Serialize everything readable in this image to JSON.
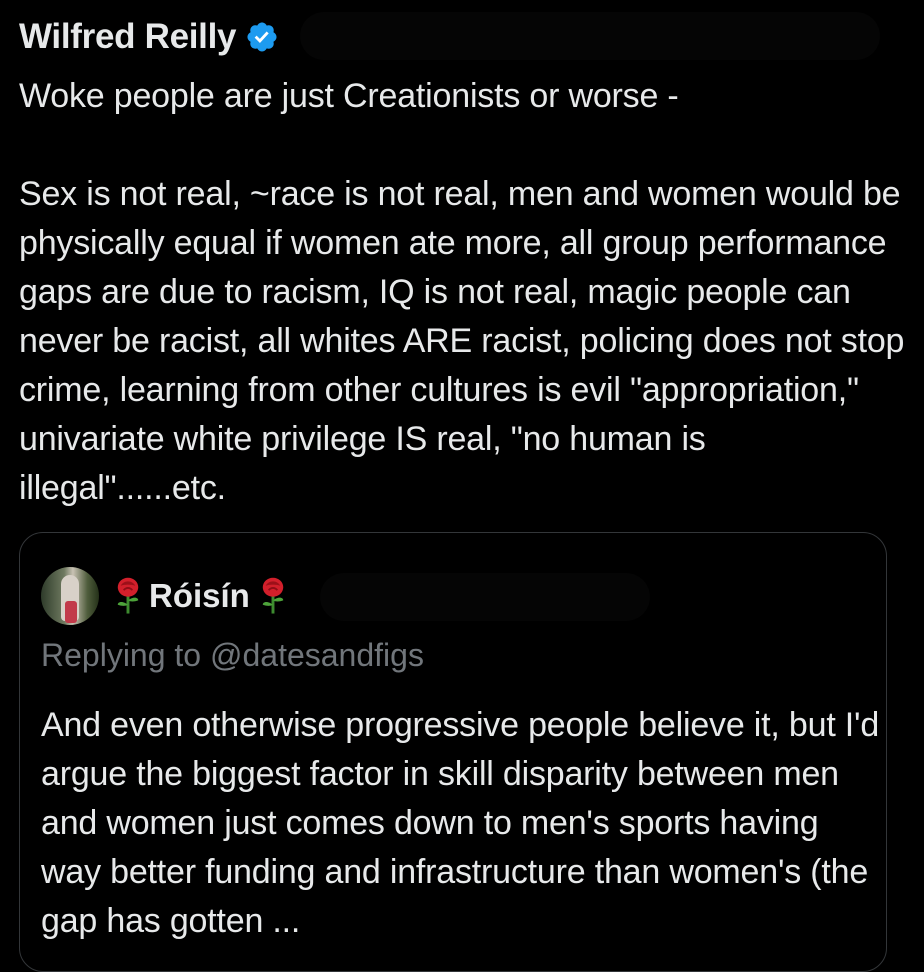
{
  "tweet": {
    "author_name": "Wilfred Reilly",
    "text": "Woke people are just Creationists or worse -\n\nSex is not real, ~race is not real, men and women would be physically equal if women ate more, all group performance gaps are due to racism, IQ is not real, magic people can never be racist, all whites ARE racist, policing does not stop crime, learning from other cultures is evil \"appropriation,\" univariate white privilege IS real, \"no human is illegal\"......etc."
  },
  "quoted_tweet": {
    "author_name": "Róisín",
    "replying_to": "Replying to @datesandfigs",
    "text": "And even otherwise progressive people believe it, but I'd argue the biggest factor in skill disparity between men and women just comes down to men's sports having way better funding and infrastructure than women's (the gap has gotten ..."
  },
  "colors": {
    "background": "#000000",
    "text_primary": "#e7e9ea",
    "text_secondary": "#71767b",
    "verified_blue": "#1d9bf0",
    "border": "#333639"
  },
  "icons": [
    "verified-badge-icon",
    "rose-icon"
  ]
}
